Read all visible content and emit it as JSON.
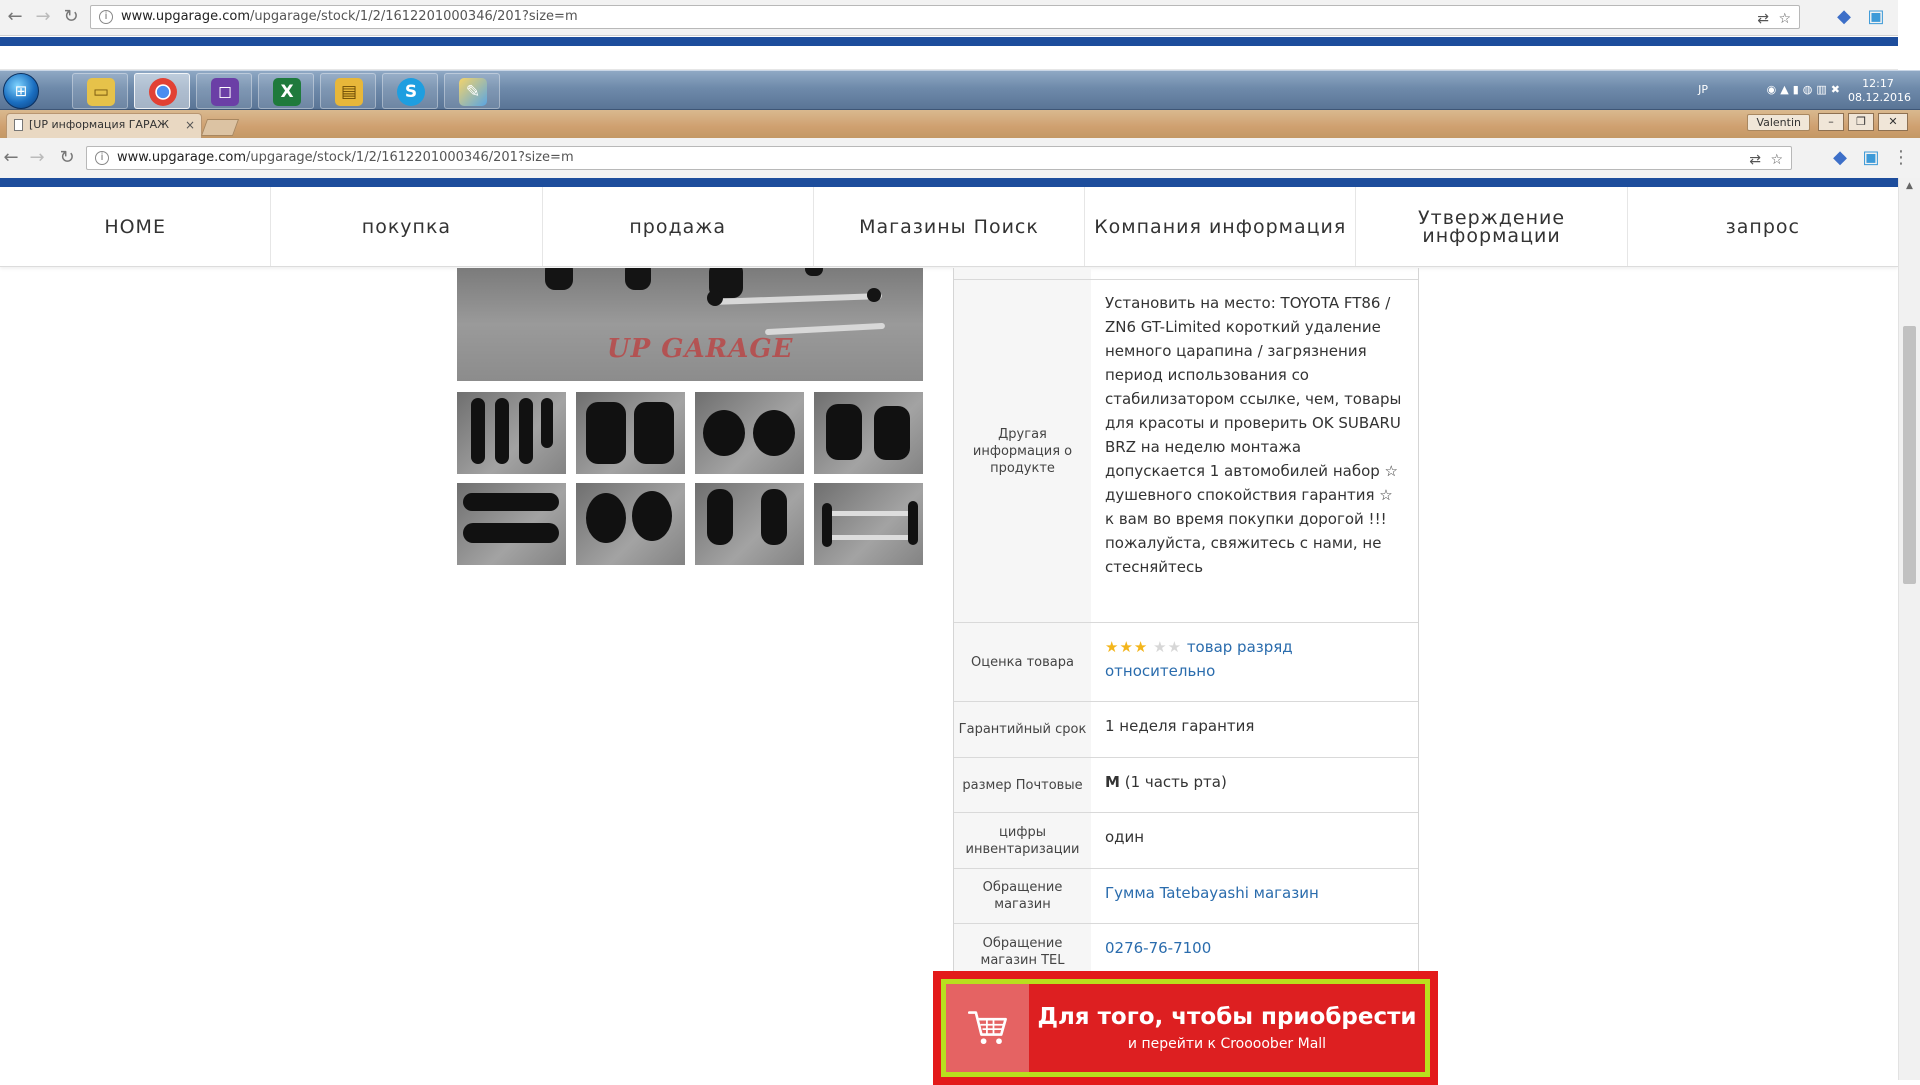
{
  "browser": {
    "outer_url_host": "www.upgarage.com",
    "outer_url_path": "/upgarage/stock/1/2/1612201000346/201?size=m",
    "inner_url_host": "www.upgarage.com",
    "inner_url_path": "/upgarage/stock/1/2/1612201000346/201?size=m",
    "tab_title": "[UP информация ГАРАЖ",
    "user_name": "Valentin"
  },
  "taskbar": {
    "lang": "JP",
    "time": "12:17",
    "date": "08.12.2016"
  },
  "nav": {
    "items": [
      "HOME",
      "покупка",
      "продажа",
      "Магазины Поиск",
      "Компания информация",
      "Утверждение информации",
      "запрос"
    ]
  },
  "product": {
    "watermark": "UP GARAGE",
    "rows": [
      {
        "label": "Другая информация о продукте",
        "value": "Установить на место: TOYOTA FT86 / ZN6 GT-Limited короткий удаление немного царапина / загрязнения период использования со стабилизатором ссылке, чем, товары для красоты и проверить OK SUBARU BRZ на неделю монтажа допускается 1 автомобилей набор ☆ душевного спокойствия гарантия ☆ к вам во время покупки дорогой !!! пожалуйста, свяжитесь с нами, не стесняйтесь"
      },
      {
        "label": "Оценка товара",
        "stars_on": "★★★",
        "stars_off": "★★",
        "rating_value": 3,
        "rating_max": 5,
        "value": "товар разряд относительно"
      },
      {
        "label": "Гарантийный срок",
        "value": "1 неделя гарантия"
      },
      {
        "label": "размер Почтовые",
        "size_letter": "M",
        "value": "(1 часть рта)"
      },
      {
        "label": "цифры инвентаризации",
        "value": "один"
      },
      {
        "label": "Обращение магазин",
        "value": "Гумма Tatebayashi магазин"
      },
      {
        "label": "Обращение магазин TEL",
        "value": "0276-76-7100"
      }
    ]
  },
  "buy_button": {
    "title": "Для того, чтобы приобрести",
    "subtitle": "и перейти к Croooober Mall"
  },
  "colors": {
    "accent_blue": "#1d4d9c",
    "buy_red": "#dd1f21",
    "buy_border": "#b9df1e",
    "link": "#2a6cad"
  }
}
